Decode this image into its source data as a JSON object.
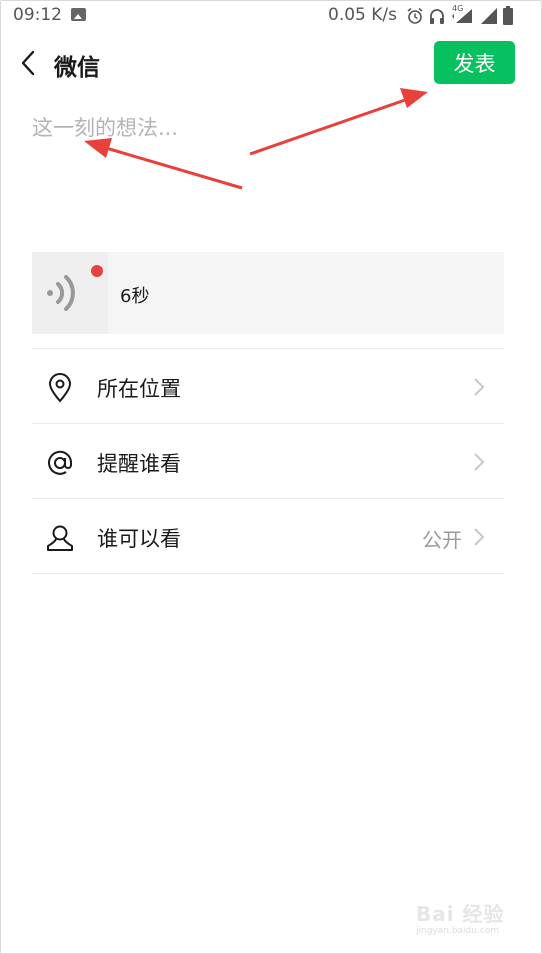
{
  "status_bar": {
    "time": "09:12",
    "speed": "0.05 K/s",
    "network_tag": "4G",
    "icons": [
      "image-icon",
      "alarm-icon",
      "headphones-icon",
      "signal-4g-icon",
      "signal-icon",
      "battery-icon"
    ]
  },
  "header": {
    "back_icon": "chevron-left-icon",
    "title": "微信",
    "post_label": "发表",
    "post_color": "#07c160"
  },
  "composer": {
    "placeholder": "这一刻的想法..."
  },
  "voice": {
    "icon": "voice-wave-icon",
    "duration": "6秒",
    "unread_dot_color": "#e64340"
  },
  "options": {
    "location": {
      "icon": "location-pin-icon",
      "label": "所在位置"
    },
    "mention": {
      "icon": "at-icon",
      "label": "提醒谁看"
    },
    "visibility": {
      "icon": "person-icon",
      "label": "谁可以看",
      "value": "公开"
    }
  },
  "watermark": {
    "text": "Bai 经验",
    "url": "jingyan.baidu.com"
  },
  "annotation_color": "#e8413b"
}
